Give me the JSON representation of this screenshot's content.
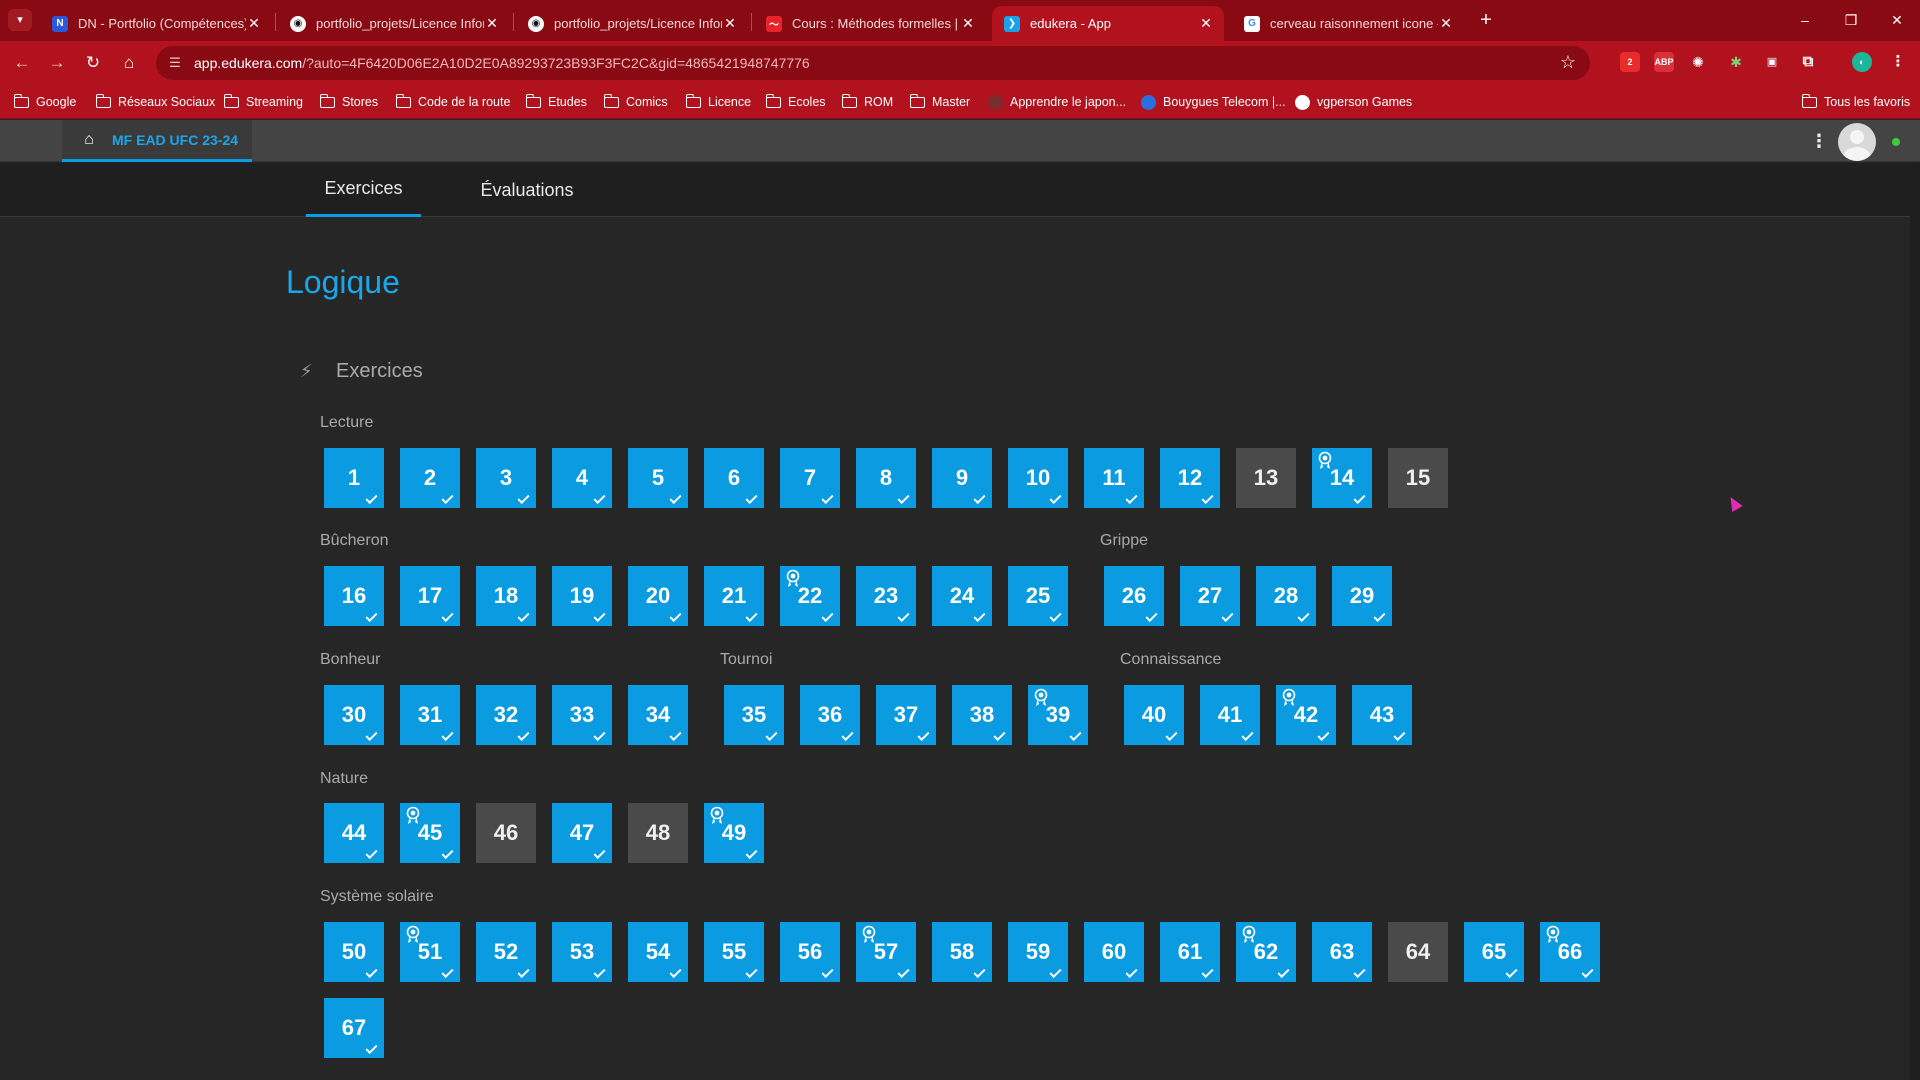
{
  "browser": {
    "tabs": [
      {
        "title": "DN - Portfolio (Compétences)",
        "favicon_color": "#2b58d9",
        "favicon_letter": "N"
      },
      {
        "title": "portfolio_projets/Licence Inform",
        "favicon_color": "#111111",
        "favicon_letter": "◉"
      },
      {
        "title": "portfolio_projets/Licence Inform",
        "favicon_color": "#111111",
        "favicon_letter": "◉"
      },
      {
        "title": "Cours : Méthodes formelles | M",
        "favicon_color": "#e8232b",
        "favicon_letter": "〜"
      },
      {
        "title": "edukera - App",
        "favicon_color": "#1aa2e8",
        "favicon_letter": "❯",
        "active": true
      },
      {
        "title": "cerveau raisonnement icone - R",
        "favicon_color": "#ffffff",
        "favicon_letter": "G"
      }
    ],
    "new_tab": "+",
    "window_controls": [
      "–",
      "❐",
      "✕"
    ],
    "url_host": "app.edukera.com",
    "url_path": "/?auto=4F6420D06E2A10D2E0A89293723B93F3FC2C&gid=4865421948747776",
    "extension_badge": "2",
    "bookmarks": [
      {
        "label": "Google",
        "type": "folder"
      },
      {
        "label": "Réseaux Sociaux",
        "type": "folder"
      },
      {
        "label": "Streaming",
        "type": "folder"
      },
      {
        "label": "Stores",
        "type": "folder"
      },
      {
        "label": "Code de la route",
        "type": "folder"
      },
      {
        "label": "Etudes",
        "type": "folder"
      },
      {
        "label": "Comics",
        "type": "folder"
      },
      {
        "label": "Licence",
        "type": "folder"
      },
      {
        "label": "Ecoles",
        "type": "folder"
      },
      {
        "label": "ROM",
        "type": "folder"
      },
      {
        "label": "Master",
        "type": "folder"
      },
      {
        "label": "Apprendre le japon...",
        "type": "site",
        "color": "#7a2d2d"
      },
      {
        "label": "Bouygues Telecom |...",
        "type": "site",
        "color": "#2a6fe0"
      },
      {
        "label": "vgperson Games",
        "type": "site",
        "color": "#ffffff"
      }
    ],
    "all_bookmarks": "Tous les favoris"
  },
  "app": {
    "course_name": "MF EAD UFC 23-24",
    "nav_tabs": [
      "Exercices",
      "Évaluations"
    ],
    "active_tab": "Exercices",
    "page_title": "Logique",
    "section_title": "Exercices",
    "accent_color": "#0b9be0",
    "groups": [
      {
        "label": "Lecture",
        "exercises": [
          {
            "n": "1",
            "done": true
          },
          {
            "n": "2",
            "done": true
          },
          {
            "n": "3",
            "done": true
          },
          {
            "n": "4",
            "done": true
          },
          {
            "n": "5",
            "done": true
          },
          {
            "n": "6",
            "done": true
          },
          {
            "n": "7",
            "done": true
          },
          {
            "n": "8",
            "done": true
          },
          {
            "n": "9",
            "done": true
          },
          {
            "n": "10",
            "done": true
          },
          {
            "n": "11",
            "done": true
          },
          {
            "n": "12",
            "done": true
          },
          {
            "n": "13",
            "done": false
          },
          {
            "n": "14",
            "done": true,
            "badge": true
          },
          {
            "n": "15",
            "done": false
          }
        ]
      },
      {
        "label": "Bûcheron",
        "exercises": [
          {
            "n": "16",
            "done": true
          },
          {
            "n": "17",
            "done": true
          },
          {
            "n": "18",
            "done": true
          },
          {
            "n": "19",
            "done": true
          },
          {
            "n": "20",
            "done": true
          },
          {
            "n": "21",
            "done": true
          },
          {
            "n": "22",
            "done": true,
            "badge": true
          },
          {
            "n": "23",
            "done": true
          },
          {
            "n": "24",
            "done": true
          },
          {
            "n": "25",
            "done": true
          }
        ]
      },
      {
        "label": "Grippe",
        "exercises": [
          {
            "n": "26",
            "done": true
          },
          {
            "n": "27",
            "done": true
          },
          {
            "n": "28",
            "done": true
          },
          {
            "n": "29",
            "done": true
          }
        ]
      },
      {
        "label": "Bonheur",
        "exercises": [
          {
            "n": "30",
            "done": true
          },
          {
            "n": "31",
            "done": true
          },
          {
            "n": "32",
            "done": true
          },
          {
            "n": "33",
            "done": true
          },
          {
            "n": "34",
            "done": true
          }
        ]
      },
      {
        "label": "Tournoi",
        "exercises": [
          {
            "n": "35",
            "done": true
          },
          {
            "n": "36",
            "done": true
          },
          {
            "n": "37",
            "done": true
          },
          {
            "n": "38",
            "done": true
          },
          {
            "n": "39",
            "done": true,
            "badge": true
          }
        ]
      },
      {
        "label": "Connaissance",
        "exercises": [
          {
            "n": "40",
            "done": true
          },
          {
            "n": "41",
            "done": true
          },
          {
            "n": "42",
            "done": true,
            "badge": true
          },
          {
            "n": "43",
            "done": true
          }
        ]
      },
      {
        "label": "Nature",
        "exercises": [
          {
            "n": "44",
            "done": true
          },
          {
            "n": "45",
            "done": true,
            "badge": true
          },
          {
            "n": "46",
            "done": false
          },
          {
            "n": "47",
            "done": true
          },
          {
            "n": "48",
            "done": false
          },
          {
            "n": "49",
            "done": true,
            "badge": true
          }
        ]
      },
      {
        "label": "Système solaire",
        "exercises": [
          {
            "n": "50",
            "done": true
          },
          {
            "n": "51",
            "done": true,
            "badge": true
          },
          {
            "n": "52",
            "done": true
          },
          {
            "n": "53",
            "done": true
          },
          {
            "n": "54",
            "done": true
          },
          {
            "n": "55",
            "done": true
          },
          {
            "n": "56",
            "done": true
          },
          {
            "n": "57",
            "done": true,
            "badge": true
          },
          {
            "n": "58",
            "done": true
          },
          {
            "n": "59",
            "done": true
          },
          {
            "n": "60",
            "done": true
          },
          {
            "n": "61",
            "done": true
          },
          {
            "n": "62",
            "done": true,
            "badge": true
          },
          {
            "n": "63",
            "done": true
          },
          {
            "n": "64",
            "done": false
          },
          {
            "n": "65",
            "done": true
          },
          {
            "n": "66",
            "done": true,
            "badge": true
          },
          {
            "n": "67",
            "done": true
          }
        ]
      }
    ]
  }
}
